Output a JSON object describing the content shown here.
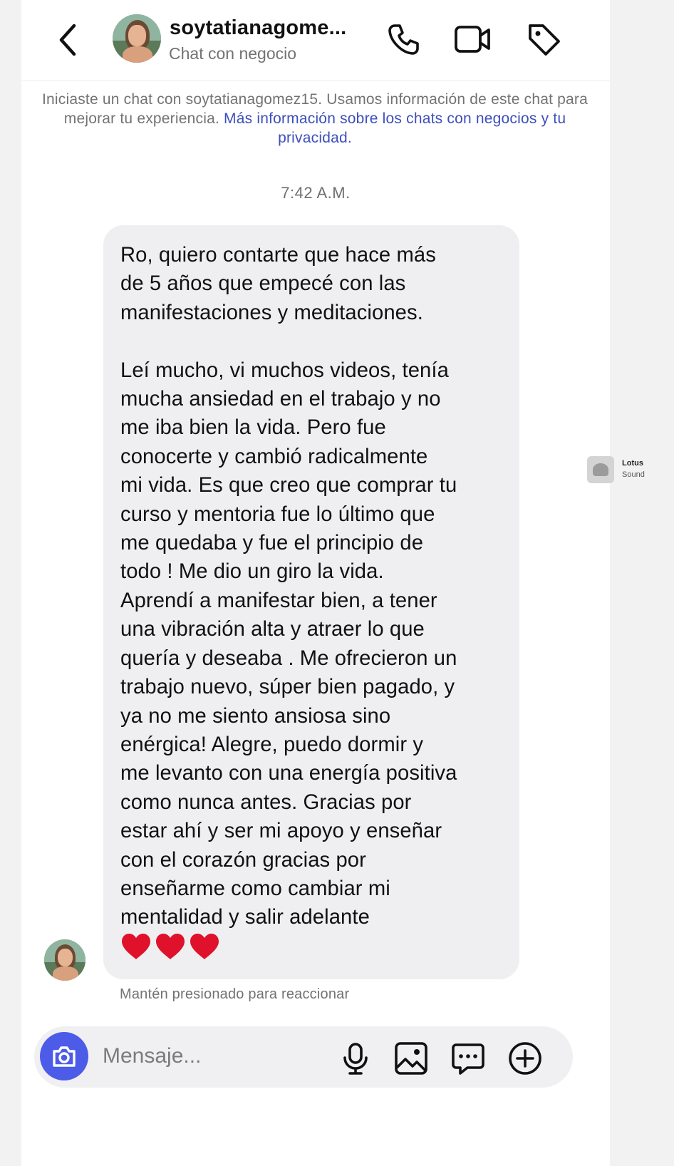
{
  "header": {
    "name": "soytatianagome...",
    "subtitle": "Chat con negocio"
  },
  "notice": {
    "text": "Iniciaste un chat con soytatianagomez15. Usamos información de este chat para mejorar tu experiencia. ",
    "link": "Más información sobre los chats con negocios y tu privacidad."
  },
  "timestamp": "7:42 A.M.",
  "message": {
    "text": "Ro, quiero contarte que hace más\nde 5 años que empecé con las\nmanifestaciones y meditaciones.\n\nLeí mucho, vi muchos videos, tenía\nmucha ansiedad en el trabajo y no\nme iba bien la vida. Pero fue\nconocerte y cambió radicalmente\nmi vida. Es que creo que comprar tu\ncurso y mentoria fue lo último que\nme quedaba y fue el principio de\ntodo ! Me dio un giro la vida.\nAprendí a manifestar bien, a tener\nuna vibración alta y atraer lo que\nquería y deseaba . Me ofrecieron un\ntrabajo nuevo, súper bien pagado, y\nya no me siento ansiosa sino\nenérgica! Alegre, puedo dormir y\nme levanto con una energía positiva\ncomo nunca antes. Gracias por\nestar ahí y ser mi apoyo y enseñar\ncon el corazón gracias por\nenseñarme como cambiar mi\nmentalidad y salir adelante",
    "hearts": 3,
    "heart_color": "#e0112b"
  },
  "hint": "Mantén presionado para reaccionar",
  "composer": {
    "placeholder": "Mensaje...",
    "camera_color": "#4c5ce8"
  },
  "side_item": {
    "title": "Lotus",
    "subtitle": "Sound"
  },
  "icons": [
    "back-icon",
    "phone-icon",
    "video-icon",
    "tag-icon",
    "camera-icon",
    "mic-icon",
    "gallery-icon",
    "sticker-icon",
    "plus-icon",
    "heart-icon"
  ]
}
